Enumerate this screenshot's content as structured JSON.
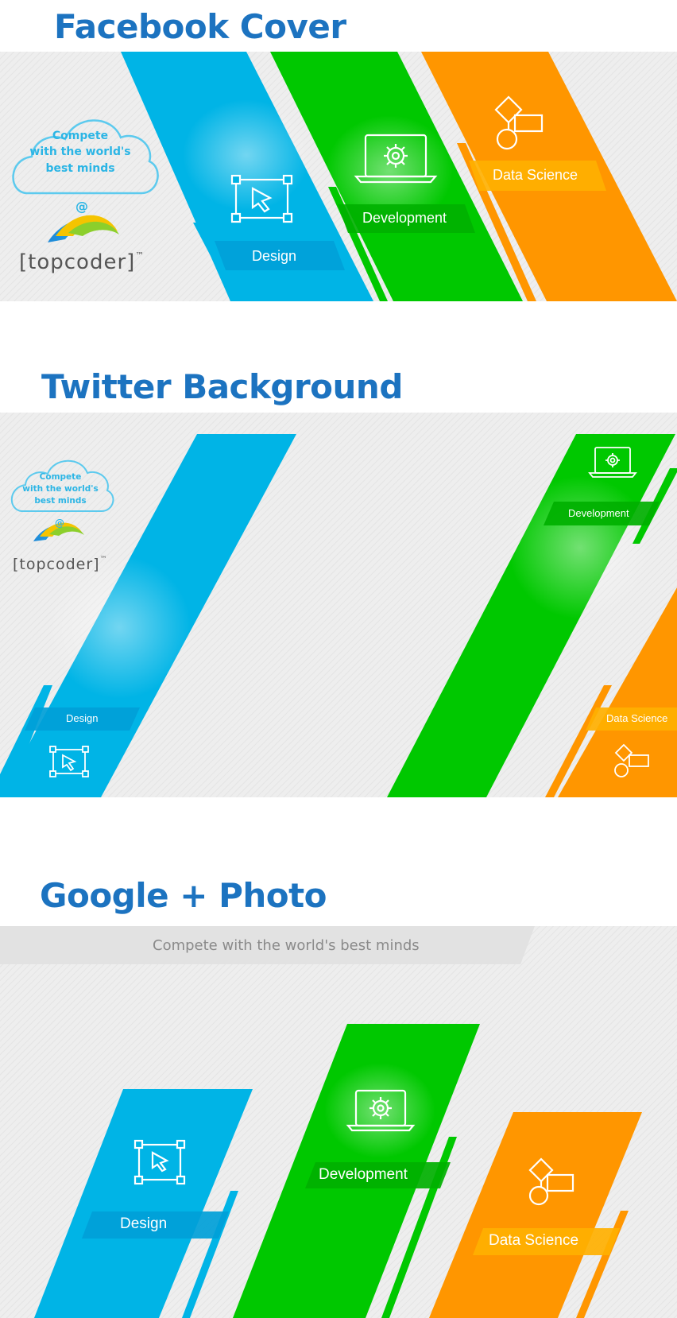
{
  "sections": {
    "facebook": {
      "heading": "Facebook Cover",
      "tagline": "Compete\nwith the world's\nbest minds",
      "at": "@",
      "brand": "[topcoder]",
      "trademark": "™",
      "design_label": "Design",
      "development_label": "Development",
      "data_science_label": "Data Science"
    },
    "twitter": {
      "heading": "Twitter Background",
      "tagline": "Compete\nwith the world's\nbest minds",
      "at": "@",
      "brand": "[topcoder]",
      "trademark": "™",
      "design_label": "Design",
      "development_label": "Development",
      "data_science_label": "Data Science"
    },
    "google": {
      "heading": "Google + Photo",
      "tagline": "Compete with the world's best minds",
      "design_label": "Design",
      "development_label": "Development",
      "data_science_label": "Data Science"
    }
  },
  "colors": {
    "heading": "#1c73c0",
    "design": "#00b4e6",
    "development": "#00c800",
    "data_science": "#ff9600",
    "cloud_text": "#2bb5e5",
    "panel_bg": "#efefef"
  },
  "icons": {
    "design": "cursor-selection-icon",
    "development": "laptop-gear-icon",
    "data_science": "flowchart-icon",
    "logo": "topcoder-swoosh-logo"
  }
}
